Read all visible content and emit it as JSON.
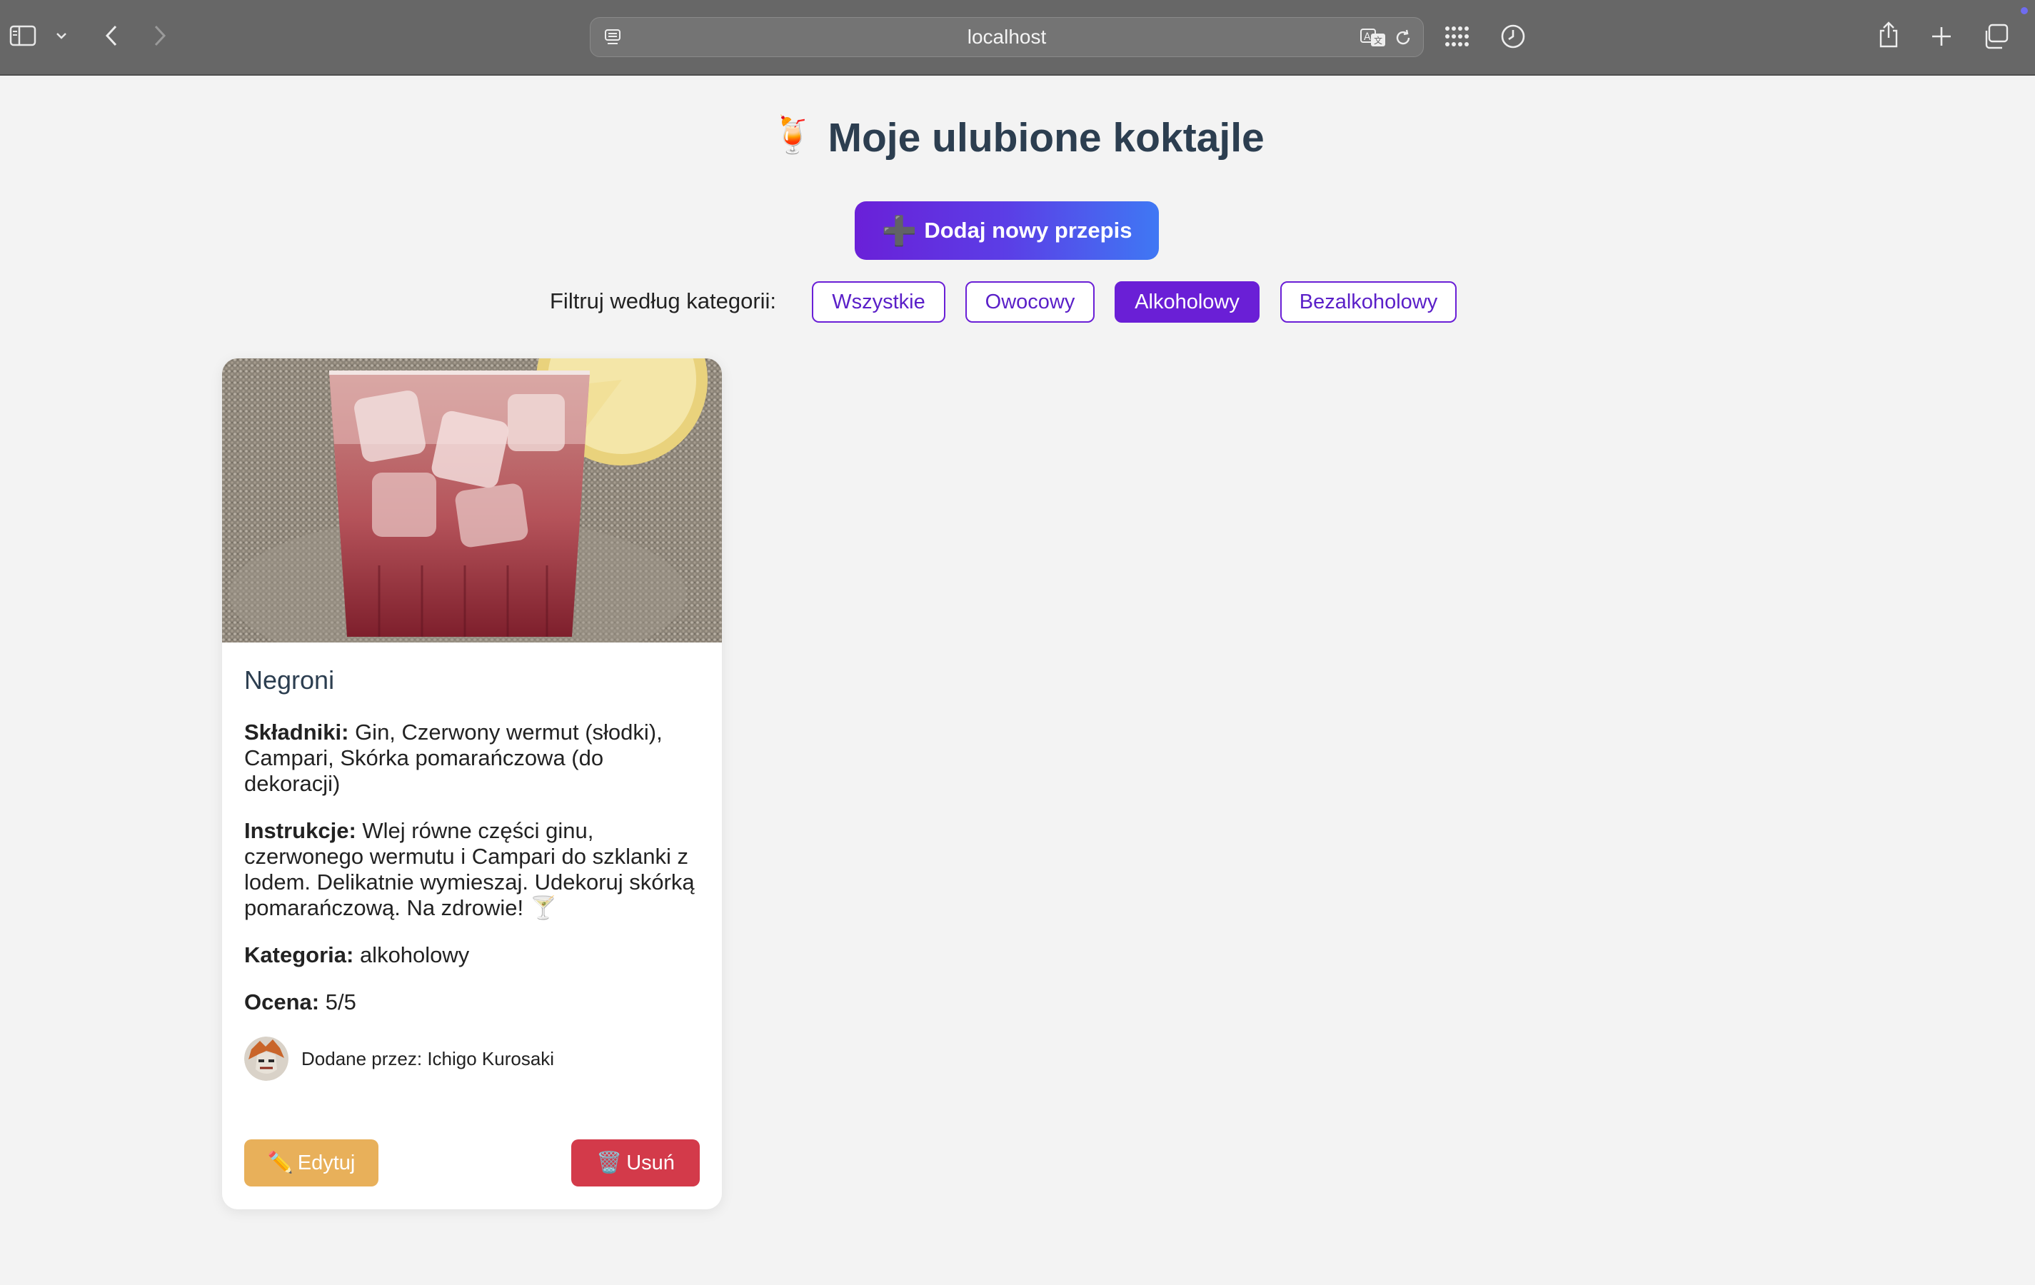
{
  "browser": {
    "url": "localhost",
    "icons": [
      "sidebar-icon",
      "chevron-down-icon",
      "back-icon",
      "forward-icon",
      "reader-icon",
      "translate-icon",
      "reload-icon",
      "grid-icon",
      "history-icon",
      "share-icon",
      "new-tab-icon",
      "tabs-overview-icon"
    ]
  },
  "page": {
    "title_emoji": "🍹",
    "title": "Moje ulubione koktajle",
    "add_button": "Dodaj nowy przepis",
    "add_icon": "➕",
    "filter_label": "Filtruj według kategorii:",
    "filters": [
      "Wszystkie",
      "Owocowy",
      "Alkoholowy",
      "Bezalkoholowy"
    ],
    "active_filter": "Alkoholowy"
  },
  "card": {
    "name": "Negroni",
    "ingredients_label": "Składniki:",
    "ingredients": "Gin, Czerwony wermut (słodki), Campari, Skórka pomarańczowa (do dekoracji)",
    "instructions_label": "Instrukcje:",
    "instructions": "Wlej równe części ginu, czerwonego wermutu i Campari do szklanki z lodem. Delikatnie wymieszaj. Udekoruj skórką pomarańczową. Na zdrowie! 🍸",
    "category_label": "Kategoria:",
    "category": "alkoholowy",
    "rating_label": "Ocena:",
    "rating": "5/5",
    "author": "Dodane przez: Ichigo Kurosaki",
    "edit_icon": "✏️",
    "edit_label": "Edytuj",
    "delete_icon": "🗑️",
    "delete_label": "Usuń"
  },
  "colors": {
    "accent": "#6a1fd6",
    "edit": "#e8b05a",
    "delete": "#d33a4a",
    "title": "#2c3e50"
  }
}
